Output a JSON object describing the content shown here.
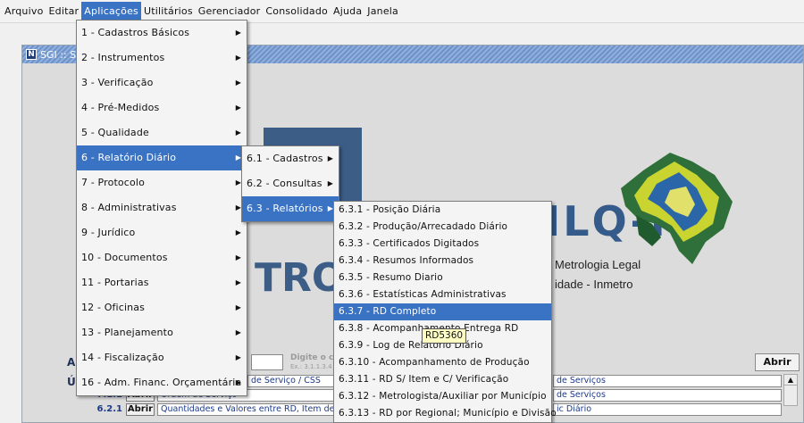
{
  "menubar": {
    "items": [
      "Arquivo",
      "Editar",
      "Aplicações",
      "Utilitários",
      "Gerenciador",
      "Consolidado",
      "Ajuda",
      "Janela"
    ],
    "active_index": 2
  },
  "frame": {
    "title": "SGI :: S",
    "icon": "N"
  },
  "splash": {
    "big_text": "RBMLQ-I",
    "tro_text": "TRO",
    "line1": "Metrologia Legal",
    "line2": "idade - Inmetro"
  },
  "access": {
    "label": "A",
    "hint_title": "Digite o camir",
    "hint_sub": "Ex.: 3.1.1.3.4",
    "open_button": "Abrir",
    "recent_label": "Ú"
  },
  "rows": [
    {
      "code": "",
      "desc_left": "de Serviço / CSS",
      "desc_right": "de Serviços"
    },
    {
      "code": "7.1.1",
      "button": "Abrir",
      "desc_left": "Ordem de Serviço",
      "desc_right": "de Serviços"
    },
    {
      "code": "6.2.1",
      "button": "Abrir",
      "desc_left": "Quantidades e Valores entre RD, Item de R",
      "desc_right": "ic Diário"
    }
  ],
  "main_menu": {
    "items": [
      "1 - Cadastros Básicos",
      "2 - Instrumentos",
      "3 - Verificação",
      "4 - Pré-Medidos",
      "5 - Qualidade",
      "6 - Relatório Diário",
      "7 - Protocolo",
      "8 - Administrativas",
      "9 - Jurídico",
      "10 - Documentos",
      "11 - Portarias",
      "12 - Oficinas",
      "13 - Planejamento",
      "14 - Fiscalização",
      "16 - Adm. Financ. Orçamentária"
    ],
    "selected_index": 5
  },
  "rd_menu": {
    "items": [
      "6.1 - Cadastros",
      "6.2 - Consultas",
      "6.3 - Relatórios"
    ],
    "selected_index": 2
  },
  "rel_menu": {
    "items": [
      "6.3.1 - Posição Diária",
      "6.3.2 - Produção/Arrecadado Diário",
      "6.3.3 - Certificados Digitados",
      "6.3.4 - Resumos Informados",
      "6.3.5 - Resumo Diario",
      "6.3.6 - Estatísticas Administrativas",
      "6.3.7 - RD Completo",
      "6.3.8 - Acompanhamento Entrega RD",
      "6.3.9 - Log de Relatório Diário",
      "6.3.10 - Acompanhamento de Produção",
      "6.3.11 - RD S/ Item e C/ Verificação",
      "6.3.12 - Metrologista/Auxiliar por Município",
      "6.3.13 - RD por Regional; Município e Divisão"
    ],
    "selected_index": 6
  },
  "tooltip": "RD5360",
  "colors": {
    "selection": "#3a73c4",
    "tooltip_bg": "#ffffc4"
  }
}
